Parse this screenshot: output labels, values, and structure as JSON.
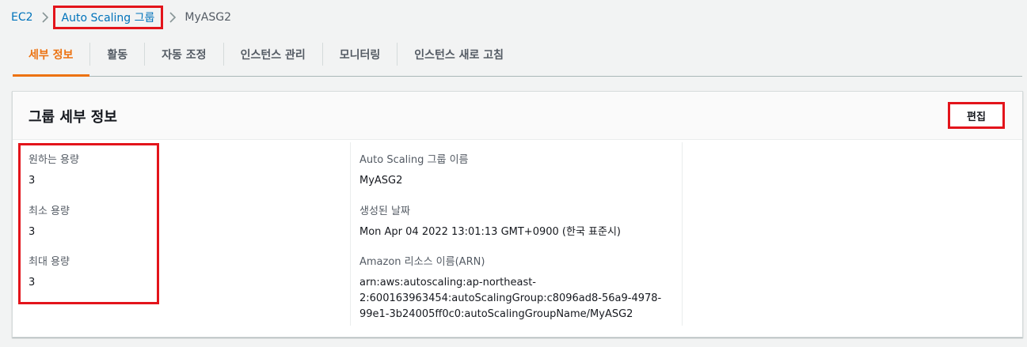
{
  "breadcrumb": {
    "root": "EC2",
    "parent": "Auto Scaling 그룹",
    "current": "MyASG2"
  },
  "tabs": [
    {
      "label": "세부 정보",
      "active": true
    },
    {
      "label": "활동"
    },
    {
      "label": "자동 조정"
    },
    {
      "label": "인스턴스 관리"
    },
    {
      "label": "모니터링"
    },
    {
      "label": "인스턴스 새로 고침"
    }
  ],
  "panel": {
    "title": "그룹 세부 정보",
    "edit_label": "편집",
    "capacity": {
      "desired_label": "원하는 용량",
      "desired_value": "3",
      "min_label": "최소 용량",
      "min_value": "3",
      "max_label": "최대 용량",
      "max_value": "3"
    },
    "info": {
      "name_label": "Auto Scaling 그룹 이름",
      "name_value": "MyASG2",
      "created_label": "생성된 날짜",
      "created_value": "Mon Apr 04 2022 13:01:13 GMT+0900 (한국 표준시)",
      "arn_label": "Amazon 리소스 이름(ARN)",
      "arn_line1": "arn:aws:autoscaling:ap-northeast-",
      "arn_line2": "2:600163963454:autoScalingGroup:c8096ad8-56a9-4978-",
      "arn_line3": "99e1-3b24005ff0c0:autoScalingGroupName/MyASG2"
    }
  },
  "colors": {
    "link": "#0073bb",
    "active_tab": "#ec7211",
    "highlight": "#e3141b"
  }
}
